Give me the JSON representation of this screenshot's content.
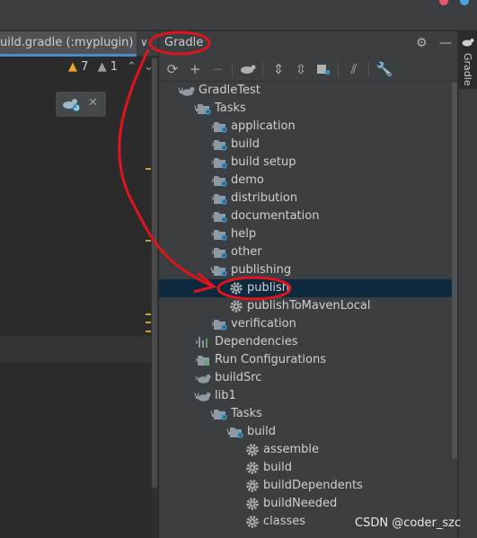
{
  "editor": {
    "tab_label": "uild.gradle (:myplugin)",
    "tab_dropdown": "∨",
    "warnings_count": "7",
    "weak_warnings_count": "1"
  },
  "gradle_panel": {
    "title": "Gradle",
    "stripe_label": "Gradle",
    "tree": {
      "root": "GradleTest",
      "tasks": "Tasks",
      "groups": [
        "application",
        "build",
        "build setup",
        "demo",
        "distribution",
        "documentation",
        "help",
        "other",
        "publishing"
      ],
      "publishing_tasks": [
        "publish",
        "publishToMavenLocal"
      ],
      "verification": "verification",
      "dependencies": "Dependencies",
      "run_configurations": "Run Configurations",
      "buildSrc": "buildSrc",
      "lib1": "lib1",
      "lib1_tasks": "Tasks",
      "lib1_build_group": "build",
      "lib1_build_tasks": [
        "assemble",
        "build",
        "buildDependents",
        "buildNeeded",
        "classes"
      ]
    }
  },
  "watermark": "CSDN @coder_szc",
  "colors": {
    "annotation_red": "#e0141e",
    "selection": "#0d293e",
    "accent_blue": "#4a88c7",
    "warning_yellow": "#f0a732"
  }
}
